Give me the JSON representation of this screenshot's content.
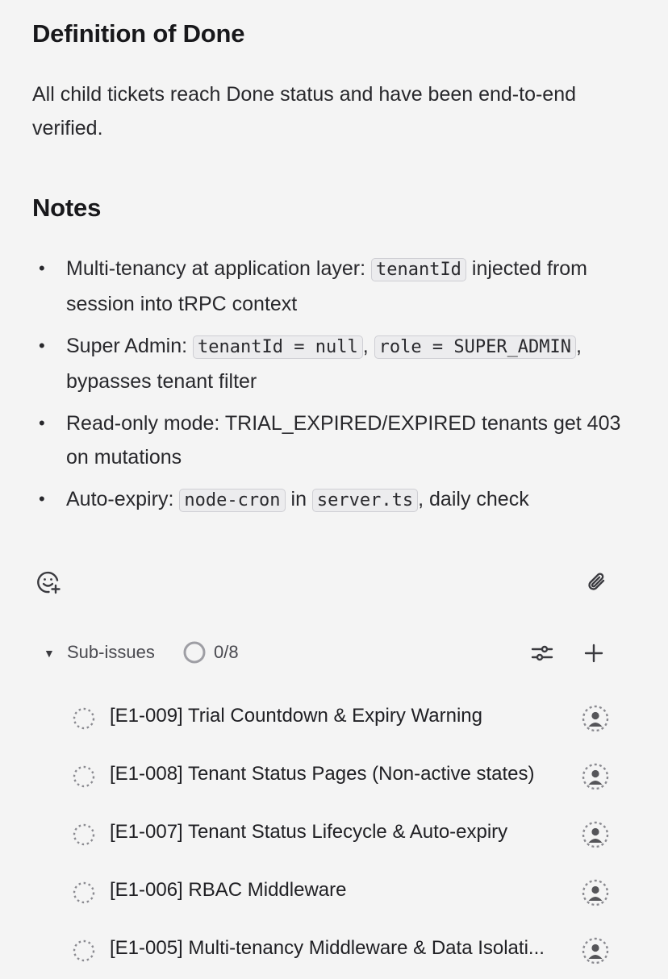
{
  "definition_of_done": {
    "heading": "Definition of Done",
    "text": "All child tickets reach Done status and have been end-to-end verified."
  },
  "notes": {
    "heading": "Notes",
    "bullet": "•",
    "items": [
      {
        "p1": "Multi-tenancy at application layer: ",
        "c1": "tenantId",
        "p2": " injected from session into tRPC context"
      },
      {
        "p1": "Super Admin: ",
        "c1": "tenantId = null",
        "p2": ", ",
        "c2": "role = SUPER_ADMIN",
        "p3": ", bypasses tenant filter"
      },
      {
        "p1": "Read-only mode: TRIAL_EXPIRED/EXPIRED tenants get 403 on mutations"
      },
      {
        "p1": "Auto-expiry: ",
        "c1": "node-cron",
        "p2": " in ",
        "c2": "server.ts",
        "p3": ", daily check"
      }
    ]
  },
  "toolbar": {
    "emoji_icon": "emoji-add-icon",
    "attach_icon": "paperclip-icon"
  },
  "sub_issues": {
    "caret": "▼",
    "title": "Sub-issues",
    "progress": "0/8",
    "progress_fraction": 0,
    "items": [
      {
        "label": "[E1-009] Trial Countdown & Expiry Warning"
      },
      {
        "label": "[E1-008] Tenant Status Pages (Non-active states)"
      },
      {
        "label": "[E1-007] Tenant Status Lifecycle & Auto-expiry"
      },
      {
        "label": "[E1-006] RBAC Middleware"
      },
      {
        "label": "[E1-005] Multi-tenancy Middleware & Data Isolati..."
      }
    ]
  },
  "colors": {
    "background": "#f4f4f4",
    "text": "#1e1e21",
    "muted": "#4a4a50",
    "code_bg": "#ececee"
  }
}
